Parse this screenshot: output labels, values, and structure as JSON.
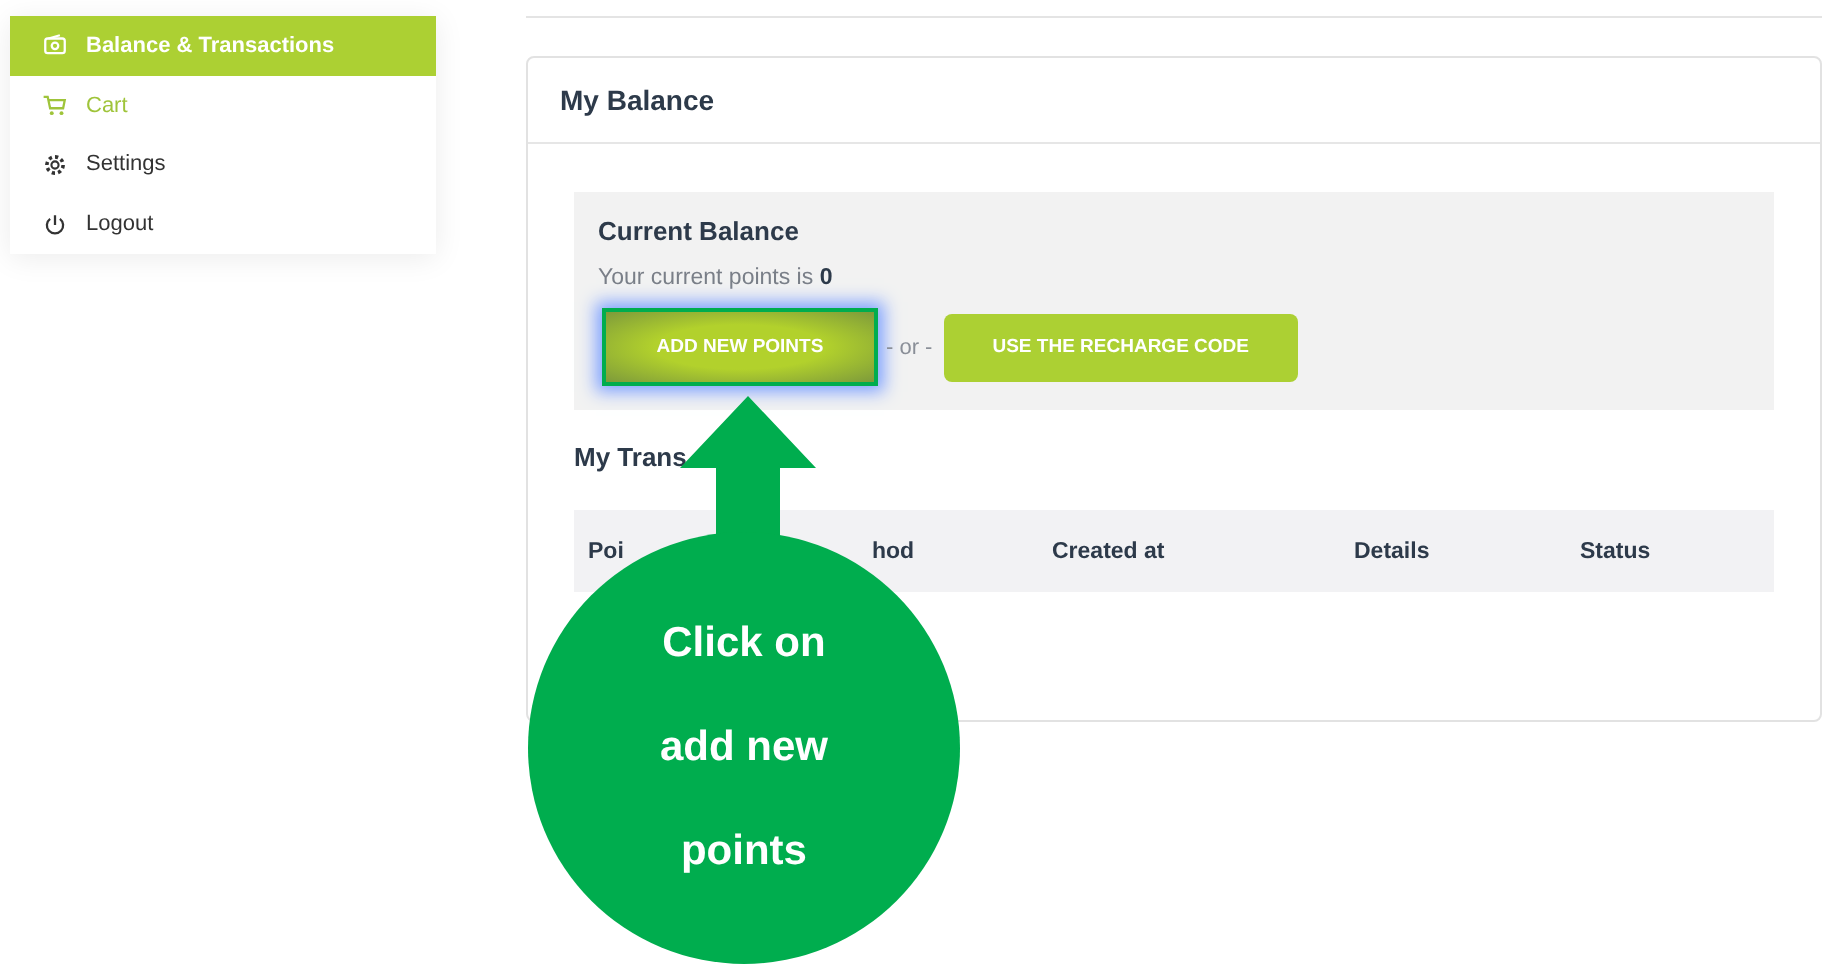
{
  "sidebar": {
    "items": [
      {
        "label": "Balance & Transactions",
        "kind": "wallet",
        "selected": true
      },
      {
        "label": "Cart",
        "kind": "cart",
        "selected": false
      },
      {
        "label": "Settings",
        "kind": "gear",
        "selected": false
      },
      {
        "label": "Logout",
        "kind": "power",
        "selected": false
      }
    ]
  },
  "balance_card": {
    "title": "My Balance",
    "current": {
      "heading": "Current Balance",
      "text": "Your current points is **0**",
      "buttons": [
        {
          "label": "ADD NEW POINTS",
          "highlighted": true
        },
        {
          "label": "USE THE RECHARGE CODE",
          "highlighted": false
        }
      ],
      "separator": "- or -"
    },
    "transactions_heading": "My Trans",
    "table": {
      "columns": [
        "Poi",
        "hod",
        "Created at",
        "Details",
        "Status"
      ]
    }
  },
  "callout": {
    "lines": [
      "Click on",
      "add new",
      "points"
    ]
  }
}
